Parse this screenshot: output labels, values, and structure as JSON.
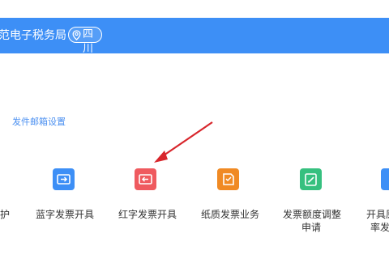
{
  "header": {
    "title": "范电子税务局",
    "region": "四川",
    "region_icon": "location-pin-icon",
    "bg_color": "#3d8ff6"
  },
  "settings_link": "发件邮箱设置",
  "tiles": [
    {
      "label": "护",
      "icon": "maintenance-icon",
      "color": "#3d8ff6"
    },
    {
      "label": "蓝字发票开具",
      "icon": "blue-invoice-icon",
      "color": "#3d8ff6"
    },
    {
      "label": "红字发票开具",
      "icon": "red-invoice-icon",
      "color": "#ef5a5f"
    },
    {
      "label": "纸质发票业务",
      "icon": "paper-invoice-icon",
      "color": "#f08a24"
    },
    {
      "label_line1": "发票额度调整",
      "label_line2": "申请",
      "icon": "quota-adjust-icon",
      "color": "#36c07f"
    },
    {
      "label_line1": "开具原",
      "label_line2": "率发",
      "icon": "issue-rate-icon",
      "color": "#3d8ff6"
    }
  ],
  "annotation": {
    "icon": "red-arrow-annotation",
    "color": "#d8262c"
  }
}
